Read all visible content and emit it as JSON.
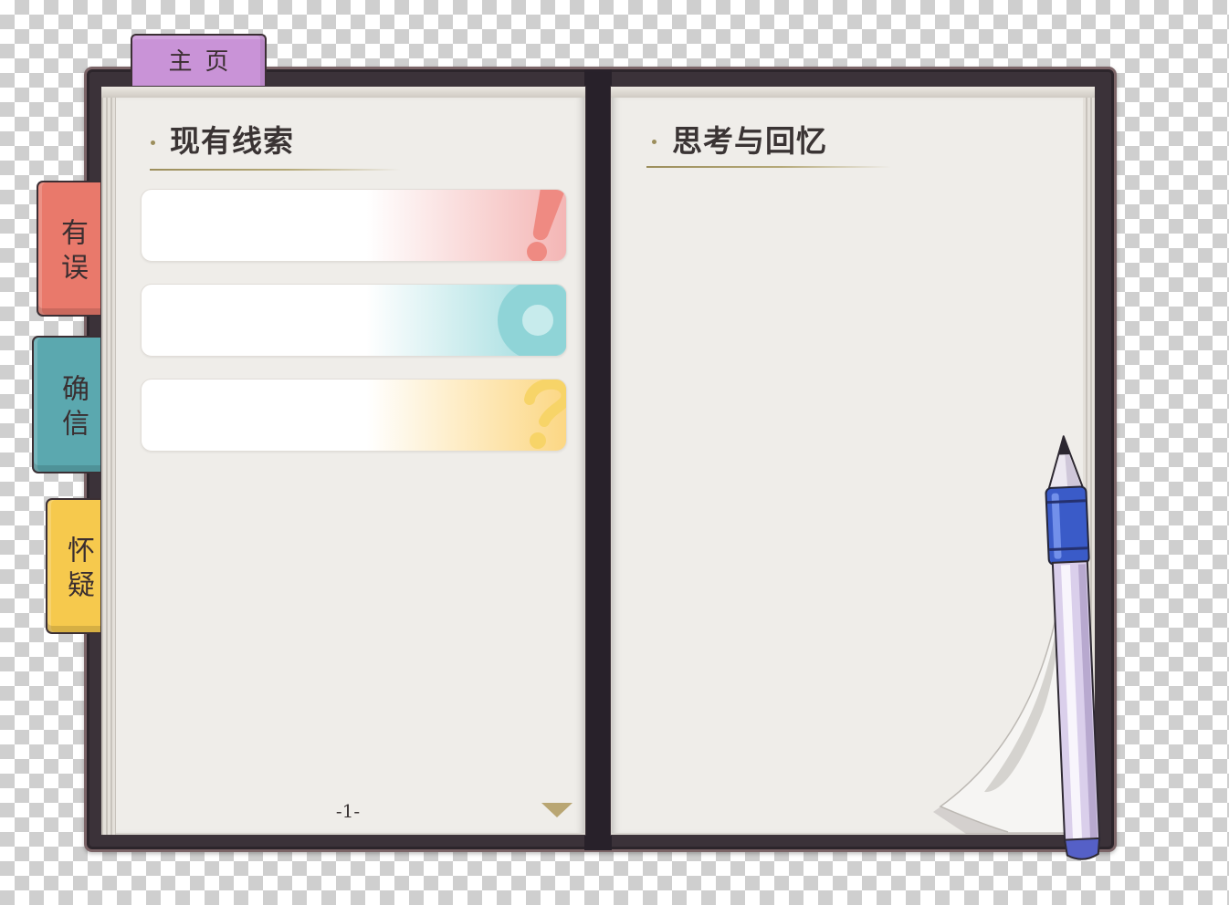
{
  "notebook": {
    "home_tab": {
      "label": "主页",
      "color": "#c993d7"
    },
    "side_tabs": [
      {
        "label": "有误",
        "color": "#e9796b"
      },
      {
        "label": "确信",
        "color": "#5ba8af"
      },
      {
        "label": "怀疑",
        "color": "#f6c94d"
      }
    ],
    "left_page": {
      "title": "现有线索",
      "clue_cards": [
        {
          "icon": "exclamation-icon",
          "accent": "#f4b6b5",
          "icon_color": "#ef8a82"
        },
        {
          "icon": "ring-icon",
          "accent": "#98d9dc",
          "icon_color": "#8fd4d7"
        },
        {
          "icon": "question-mark-icon",
          "accent": "#fcd784",
          "icon_color": "#f7d468"
        }
      ],
      "page_number": "-1-",
      "next_page_icon": "triangle-down-icon"
    },
    "right_page": {
      "title": "思考与回忆",
      "pen_icon": "pen-icon",
      "page_curl_icon": "page-curl-icon"
    }
  },
  "colors": {
    "cover": "#3b3239",
    "paper": "#efede9",
    "ink": "#3a3434",
    "title_rule": "#9c8e5c",
    "next_arrow": "#b9a673"
  }
}
